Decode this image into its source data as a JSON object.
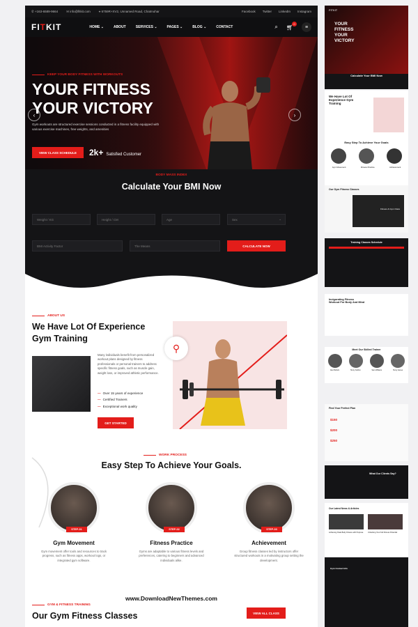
{
  "topbar": {
    "phone": "+163-6589-9664",
    "email": "info@fitkit.com",
    "address": "6759R+XV2, Unnamed Road, Chatmohar",
    "socials": [
      "Facebook",
      "Twitter",
      "LinkedIn",
      "Instagram"
    ]
  },
  "nav": {
    "logo_a": "FI",
    "logo_x": "T",
    "logo_b": "KIT",
    "items": [
      "HOME ⌄",
      "ABOUT",
      "SERVICES ⌄",
      "PAGES ⌄",
      "BLOG ⌄",
      "CONTACT"
    ],
    "cart_count": "0"
  },
  "hero": {
    "tag": "KEEP YOUR BODY FITNESS WITH WORKOUTS",
    "title_line1": "YOUR FITNESS",
    "title_line2": "YOUR VICTORY",
    "description": "Gym workouts are structured exercise sessions conducted in a fitness facility equipped with various exercise machines, free weights, and amenities",
    "cta": "VIEW CLASS SCHEDULE",
    "stat_number": "2k+",
    "stat_label": "Satisfied Customer"
  },
  "bmi": {
    "tag": "BODY MASS INDEX",
    "title": "Calculate Your BMI Now",
    "fields": [
      "Weight / KG",
      "Height / CM",
      "Age",
      "Sex",
      "BMI Activity Factor",
      "The Means"
    ],
    "button": "CALCULATE NOW"
  },
  "about": {
    "tag": "ABOUT US",
    "title": "We Have Lot Of Experience Gym Training",
    "description": "Many individuals benefit from personalized workout plans designed by fitness professionals or personal trainers to address specific fitness goals, such as muscle gain, weight loss, or improved athletic performance.",
    "features": [
      "Over 15 years of experience",
      "Certified Trainers",
      "Exceptional work quality"
    ],
    "button": "GET STARTED"
  },
  "steps": {
    "tag": "WORK PROCESS",
    "title": "Easy Step To Achieve Your Goals.",
    "items": [
      {
        "badge": "STEP-01",
        "title": "Gym Movement",
        "text": "Gym movement offer tools and resources to track progress, such as fitness apps, workout logs, or integrated gym software."
      },
      {
        "badge": "STEP-02",
        "title": "Fitness Practice",
        "text": "Gyms are adaptable to various fitness levels and preferences, catering to beginners and advanced individuals alike."
      },
      {
        "badge": "STEP-03",
        "title": "Achievement",
        "text": "Group fitness classes led by instructors offer structured workouts in a motivating group setting the development."
      }
    ]
  },
  "classes": {
    "tag": "GYM & FITNESS TRAINING",
    "title": "Our Gym Fitness Classes",
    "button": "VIEW ALL CLASS"
  },
  "watermark": "www.DownloadNewThemes.com",
  "preview": {
    "hero_title": "YOUR FITNESS YOUR VICTORY",
    "bmi_title": "Calculate Your BMI Now",
    "about_title": "We Have Lot Of Experience Gym Training",
    "steps_title": "Easy Step To Achieve Your Goals",
    "steps": [
      "Gym Movement",
      "Fitness Practice",
      "Achievement"
    ],
    "classes_title": "Our Gym Fitness Classes",
    "classes_card": "Fitness & Gym Class",
    "schedule_title": "Training Classes Schedule",
    "invigorating_title": "Invigorating Fitness Workout For Body And Mind",
    "trainers_title": "Meet Our Skilled Trainer",
    "trainers": [
      "Alex Bullock",
      "Henry Carlton",
      "Sam Williams",
      "Henry James"
    ],
    "pricing_title": "Find Your Perfect Plan",
    "prices": [
      "$150",
      "$200",
      "$250"
    ],
    "testimonial_title": "What Our Clients Say?",
    "news_title": "Our Latest News & Articles",
    "news_items": [
      "Achieving Peak Body Fitness with Purpose",
      "Unlocking Your Full Fitness Potential"
    ],
    "contact_title": "Gym Contact Info"
  },
  "colors": {
    "accent": "#e31d1a",
    "dark": "#141416",
    "light_pink": "#f8e4e4"
  }
}
